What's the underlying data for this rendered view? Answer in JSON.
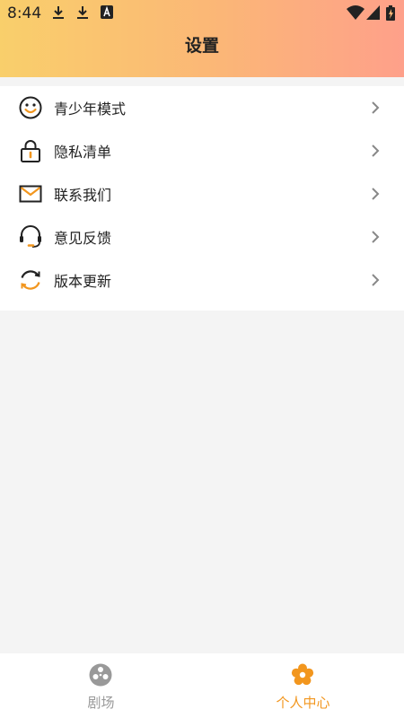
{
  "status_bar": {
    "time": "8:44"
  },
  "header": {
    "title": "设置"
  },
  "settings": {
    "items": [
      {
        "label": "青少年模式",
        "icon": "smiley-icon"
      },
      {
        "label": "隐私清单",
        "icon": "lock-icon"
      },
      {
        "label": "联系我们",
        "icon": "mail-icon"
      },
      {
        "label": "意见反馈",
        "icon": "headset-icon"
      },
      {
        "label": "版本更新",
        "icon": "refresh-icon"
      }
    ]
  },
  "tabbar": {
    "tabs": [
      {
        "label": "剧场",
        "icon": "film-reel-icon",
        "active": false
      },
      {
        "label": "个人中心",
        "icon": "flower-icon",
        "active": true
      }
    ]
  },
  "colors": {
    "accent": "#f2961e",
    "header_gradient_start": "#f9cf6b",
    "header_gradient_end": "#fea08a",
    "inactive_tab": "#999999"
  }
}
